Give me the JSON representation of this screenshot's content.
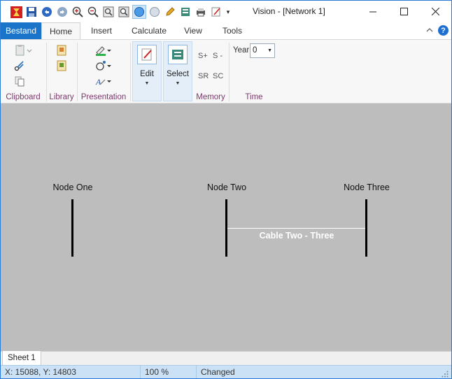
{
  "window": {
    "title": "Vision - [Network 1]"
  },
  "ribbon": {
    "file_tab": "Bestand",
    "tabs": [
      "Home",
      "Insert",
      "Calculate",
      "View",
      "Tools"
    ],
    "groups": {
      "clipboard": "Clipboard",
      "library": "Library",
      "presentation": "Presentation",
      "memory": "Memory",
      "time": "Time"
    },
    "edit_label": "Edit",
    "select_label": "Select",
    "memory_buttons": [
      "S+",
      "S -",
      "SR",
      "SC"
    ],
    "year_label": "Year",
    "year_value": "0"
  },
  "network": {
    "nodes": [
      {
        "label": "Node One"
      },
      {
        "label": "Node Two"
      },
      {
        "label": "Node Three"
      }
    ],
    "cables": [
      {
        "label": "Cable Two - Three",
        "from": "Node Two",
        "to": "Node Three"
      }
    ]
  },
  "sheets": [
    "Sheet 1"
  ],
  "status": {
    "coords": "X: 15088, Y: 14803",
    "zoom": "100 %",
    "state": "Changed"
  },
  "colors": {
    "accent": "#1a74c9",
    "canvas": "#bdbdbd",
    "statusbar": "#cbe2f6"
  }
}
